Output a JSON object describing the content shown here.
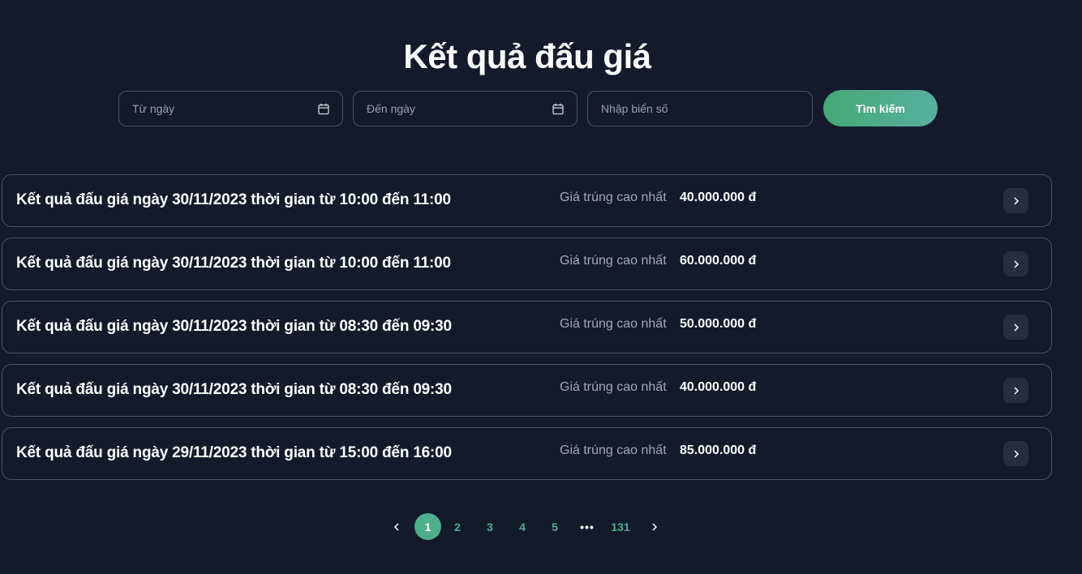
{
  "page": {
    "title": "Kết quả đấu giá"
  },
  "filters": {
    "from_date_placeholder": "Từ ngày",
    "to_date_placeholder": "Đến ngày",
    "plate_placeholder": "Nhập biển số",
    "search_label": "Tìm kiếm",
    "calendar_icon": "calendar-icon"
  },
  "results": [
    {
      "title": "Kết quả đấu giá ngày 30/11/2023 thời gian từ 10:00 đến 11:00",
      "price_label": "Giá trúng cao nhất",
      "price": "40.000.000 đ"
    },
    {
      "title": "Kết quả đấu giá ngày 30/11/2023 thời gian từ 10:00 đến 11:00",
      "price_label": "Giá trúng cao nhất",
      "price": "60.000.000 đ"
    },
    {
      "title": "Kết quả đấu giá ngày 30/11/2023 thời gian từ 08:30 đến 09:30",
      "price_label": "Giá trúng cao nhất",
      "price": "50.000.000 đ"
    },
    {
      "title": "Kết quả đấu giá ngày 30/11/2023 thời gian từ 08:30 đến 09:30",
      "price_label": "Giá trúng cao nhất",
      "price": "40.000.000 đ"
    },
    {
      "title": "Kết quả đấu giá ngày 29/11/2023 thời gian từ 15:00 đến 16:00",
      "price_label": "Giá trúng cao nhất",
      "price": "85.000.000 đ"
    }
  ],
  "pagination": {
    "current": "1",
    "pages": [
      "1",
      "2",
      "3",
      "4",
      "5"
    ],
    "ellipsis": "•••",
    "last": "131"
  },
  "colors": {
    "background": "#141a2c",
    "accent": "#4fae8b",
    "border": "#4b5366"
  }
}
